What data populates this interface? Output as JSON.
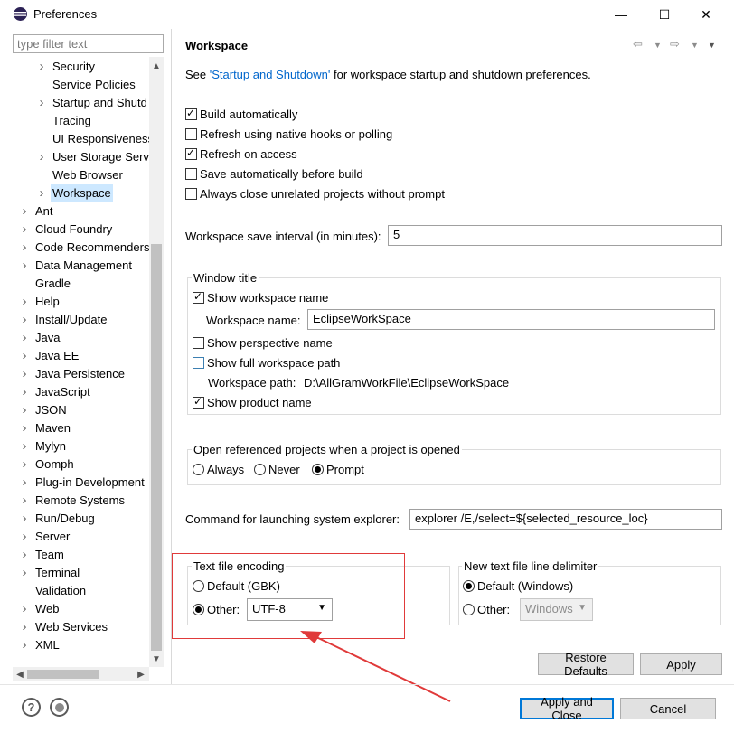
{
  "window": {
    "title": "Preferences",
    "minimize": "—",
    "maximize": "☐",
    "close": "✕"
  },
  "filter": {
    "placeholder": "type filter text"
  },
  "tree": {
    "items": [
      {
        "label": "Security",
        "expandable": true
      },
      {
        "label": "Service Policies",
        "expandable": false
      },
      {
        "label": "Startup and Shutd",
        "expandable": true
      },
      {
        "label": "Tracing",
        "expandable": false
      },
      {
        "label": "UI Responsiveness",
        "expandable": false
      },
      {
        "label": "User Storage Serv",
        "expandable": true
      },
      {
        "label": "Web Browser",
        "expandable": false
      },
      {
        "label": "Workspace",
        "expandable": true,
        "selected": true
      },
      {
        "label": "Ant",
        "expandable": true
      },
      {
        "label": "Cloud Foundry",
        "expandable": true
      },
      {
        "label": "Code Recommenders",
        "expandable": true
      },
      {
        "label": "Data Management",
        "expandable": true
      },
      {
        "label": "Gradle",
        "expandable": false
      },
      {
        "label": "Help",
        "expandable": true
      },
      {
        "label": "Install/Update",
        "expandable": true
      },
      {
        "label": "Java",
        "expandable": true
      },
      {
        "label": "Java EE",
        "expandable": true
      },
      {
        "label": "Java Persistence",
        "expandable": true
      },
      {
        "label": "JavaScript",
        "expandable": true
      },
      {
        "label": "JSON",
        "expandable": true
      },
      {
        "label": "Maven",
        "expandable": true
      },
      {
        "label": "Mylyn",
        "expandable": true
      },
      {
        "label": "Oomph",
        "expandable": true
      },
      {
        "label": "Plug-in Development",
        "expandable": true
      },
      {
        "label": "Remote Systems",
        "expandable": true
      },
      {
        "label": "Run/Debug",
        "expandable": true
      },
      {
        "label": "Server",
        "expandable": true
      },
      {
        "label": "Team",
        "expandable": true
      },
      {
        "label": "Terminal",
        "expandable": true
      },
      {
        "label": "Validation",
        "expandable": false
      },
      {
        "label": "Web",
        "expandable": true
      },
      {
        "label": "Web Services",
        "expandable": true
      },
      {
        "label": "XML",
        "expandable": true
      }
    ]
  },
  "page": {
    "title": "Workspace",
    "see_prefix": "See ",
    "see_link": "'Startup and Shutdown'",
    "see_suffix": " for workspace startup and shutdown preferences.",
    "checks": [
      {
        "label": "Build automatically",
        "checked": true
      },
      {
        "label": "Refresh using native hooks or polling",
        "checked": false
      },
      {
        "label": "Refresh on access",
        "checked": true
      },
      {
        "label": "Save automatically before build",
        "checked": false
      },
      {
        "label": "Always close unrelated projects without prompt",
        "checked": false
      }
    ],
    "save_interval_label": "Workspace save interval (in minutes):",
    "save_interval_value": "5",
    "window_title": {
      "group_label": "Window title",
      "show_workspace_name": "Show workspace name",
      "show_workspace_name_checked": true,
      "workspace_name_label": "Workspace name:",
      "workspace_name_value": "EclipseWorkSpace",
      "show_perspective_name": "Show perspective name",
      "show_perspective_name_checked": false,
      "show_full_path": "Show full workspace path",
      "show_full_path_checked": false,
      "workspace_path_label": "Workspace path:",
      "workspace_path_value": "D:\\AllGramWorkFile\\EclipseWorkSpace",
      "show_product_name": "Show product name",
      "show_product_name_checked": true
    },
    "open_referenced": {
      "group_label": "Open referenced projects when a project is opened",
      "options": [
        "Always",
        "Never",
        "Prompt"
      ],
      "selected": "Prompt"
    },
    "command_label": "Command for launching system explorer:",
    "command_value": "explorer /E,/select=${selected_resource_loc}",
    "encoding": {
      "group_label": "Text file encoding",
      "default_label": "Default (GBK)",
      "other_label": "Other:",
      "other_value": "UTF-8",
      "selected": "Other"
    },
    "line_delimiter": {
      "group_label": "New text file line delimiter",
      "default_label": "Default (Windows)",
      "other_label": "Other:",
      "other_value": "Windows",
      "selected": "Default"
    },
    "restore_defaults": "Restore Defaults",
    "apply": "Apply"
  },
  "footer": {
    "help_icon": "?",
    "apply_and_close": "Apply and Close",
    "cancel": "Cancel"
  },
  "colors": {
    "selection": "#cde8ff",
    "link": "#0066cc",
    "highlight_box": "#e03a3a",
    "default_button_border": "#0078d7"
  }
}
